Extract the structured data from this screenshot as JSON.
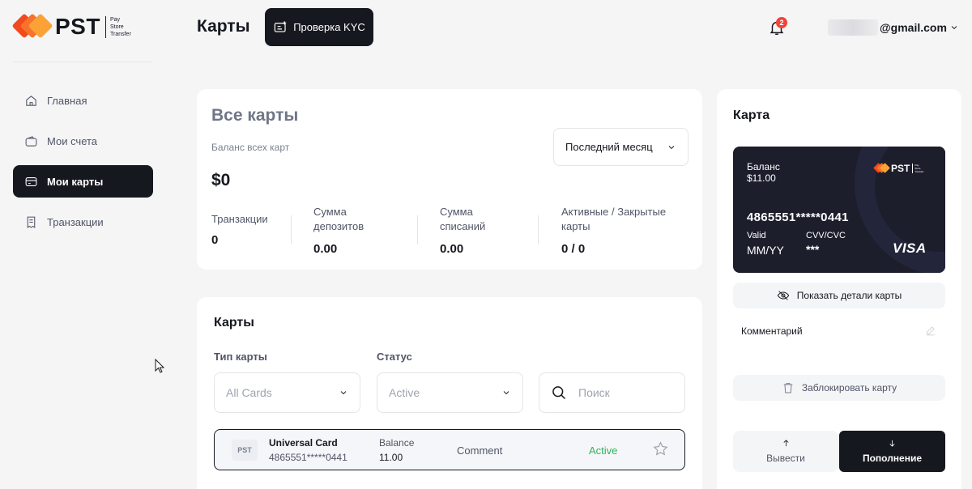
{
  "brand": {
    "name": "PST",
    "tagline": [
      "Pay",
      "Store",
      "Transfer"
    ]
  },
  "sidebar": {
    "items": [
      {
        "label": "Главная",
        "icon": "home-icon",
        "active": false
      },
      {
        "label": "Мои счета",
        "icon": "wallet-icon",
        "active": false
      },
      {
        "label": "Мои карты",
        "icon": "credit-card-icon",
        "active": true
      },
      {
        "label": "Транзакции",
        "icon": "receipt-icon",
        "active": false
      }
    ]
  },
  "header": {
    "title": "Карты",
    "kyc_label": "Проверка KYC",
    "notifications_count": "2",
    "user_email_suffix": "@gmail.com"
  },
  "summary": {
    "title": "Все карты",
    "subtitle": "Баланс всех карт",
    "balance": "$0",
    "period": "Последний месяц",
    "stats": [
      {
        "label": "Транзакции",
        "value": "0"
      },
      {
        "label": "Сумма депозитов",
        "value": "0.00"
      },
      {
        "label": "Сумма списаний",
        "value": "0.00"
      },
      {
        "label": "Активные / Закрытые карты",
        "value": "0 / 0"
      }
    ]
  },
  "cards_list": {
    "title": "Карты",
    "filter_type_label": "Тип карты",
    "filter_type_value": "All Cards",
    "filter_status_label": "Статус",
    "filter_status_value": "Active",
    "search_placeholder": "Поиск",
    "rows": [
      {
        "logo": "PST",
        "name": "Universal Card",
        "number": "4865551*****0441",
        "balance_label": "Balance",
        "balance": "11.00",
        "comment": "Comment",
        "status": "Active"
      }
    ]
  },
  "card_panel": {
    "title": "Карта",
    "card": {
      "balance_label": "Баланс",
      "balance": "$11.00",
      "logo": "PST",
      "number": "4865551*****0441",
      "valid_label": "Valid",
      "valid_value": "MM/YY",
      "cvv_label": "CVV/CVC",
      "cvv_value": "***",
      "network": "VISA"
    },
    "show_details_label": "Показать детали карты",
    "comment_label": "Комментарий",
    "block_label": "Заблокировать карту",
    "withdraw_label": "Вывести",
    "topup_label": "Пополнение"
  },
  "colors": {
    "dark": "#16181f",
    "active_status": "#31b35a",
    "badge": "#f04438",
    "brand_orange": [
      "#f24a1c",
      "#f7722a",
      "#fba237"
    ]
  }
}
